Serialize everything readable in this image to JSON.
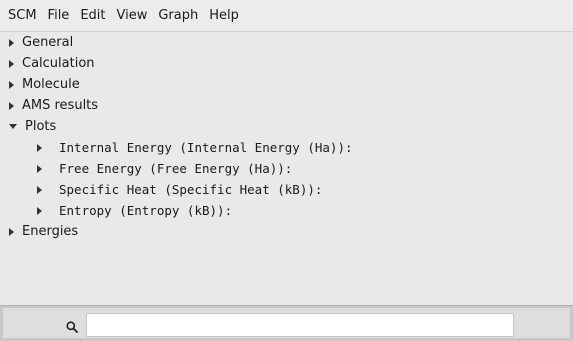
{
  "menubar": {
    "items": [
      {
        "label": "SCM"
      },
      {
        "label": "File"
      },
      {
        "label": "Edit"
      },
      {
        "label": "View"
      },
      {
        "label": "Graph"
      },
      {
        "label": "Help"
      }
    ]
  },
  "tree": {
    "nodes": [
      {
        "label": "General",
        "expanded": false
      },
      {
        "label": "Calculation",
        "expanded": false
      },
      {
        "label": "Molecule",
        "expanded": false
      },
      {
        "label": "AMS results",
        "expanded": false
      },
      {
        "label": "Plots",
        "expanded": true,
        "children": [
          {
            "label": "Internal Energy (Internal Energy (Ha)):",
            "expanded": false
          },
          {
            "label": "Free Energy (Free Energy (Ha)):",
            "expanded": false
          },
          {
            "label": "Specific Heat (Specific Heat (kB)):",
            "expanded": false
          },
          {
            "label": "Entropy (Entropy (kB)):",
            "expanded": false
          }
        ]
      },
      {
        "label": "Energies",
        "expanded": false
      }
    ]
  },
  "search": {
    "icon": "search-icon",
    "value": "",
    "placeholder": ""
  }
}
